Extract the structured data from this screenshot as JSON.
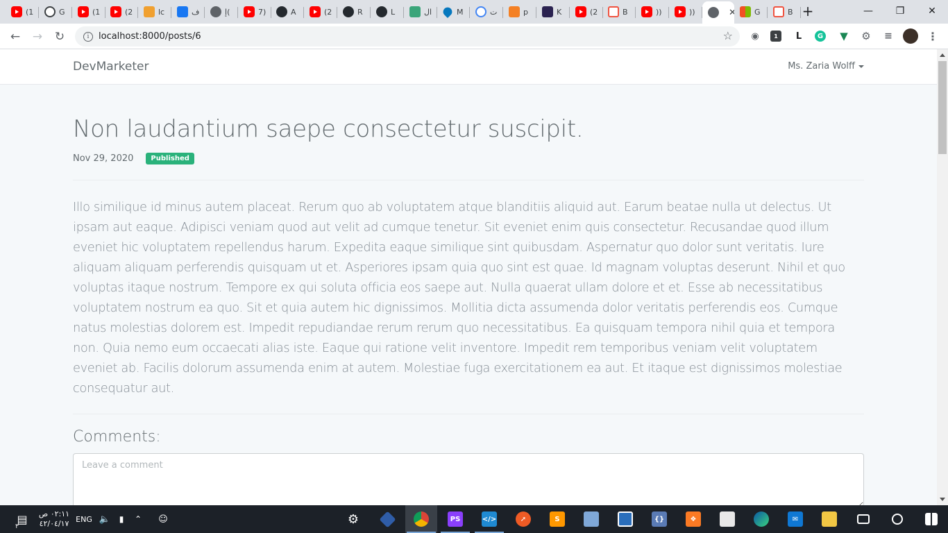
{
  "browser": {
    "tabs": [
      {
        "icon": "youtube-icon",
        "title": "(1"
      },
      {
        "icon": "clock-icon",
        "title": "G"
      },
      {
        "icon": "youtube-icon",
        "title": "(1"
      },
      {
        "icon": "youtube-icon",
        "title": "(2"
      },
      {
        "icon": "phpmyadmin-icon",
        "title": "lc"
      },
      {
        "icon": "facebook-icon",
        "title": "ف"
      },
      {
        "icon": "globe-icon",
        "title": "إ("
      },
      {
        "icon": "youtube-icon",
        "title": "7)"
      },
      {
        "icon": "github-icon",
        "title": "A"
      },
      {
        "icon": "youtube-icon",
        "title": "(2"
      },
      {
        "icon": "github-icon",
        "title": "R"
      },
      {
        "icon": "github-icon",
        "title": "L"
      },
      {
        "icon": "book-icon",
        "title": "ال"
      },
      {
        "icon": "drupal-icon",
        "title": "M"
      },
      {
        "icon": "google-icon",
        "title": "ت"
      },
      {
        "icon": "stackoverflow-icon",
        "title": "p"
      },
      {
        "icon": "k-icon",
        "title": "K"
      },
      {
        "icon": "youtube-icon",
        "title": "(2"
      },
      {
        "icon": "laravel-icon",
        "title": "B"
      },
      {
        "icon": "youtube-icon",
        "title": "))"
      },
      {
        "icon": "youtube-icon",
        "title": "))"
      },
      {
        "icon": "globe-icon",
        "title": ""
      },
      {
        "icon": "microsoft-icon",
        "title": "G"
      },
      {
        "icon": "laravel-icon",
        "title": "B"
      }
    ],
    "url": "localhost:8000/posts/6",
    "extension_letter": "L",
    "extension_badge": "1"
  },
  "app": {
    "brand": "DevMarketer",
    "user_name": "Ms. Zaria Wolff"
  },
  "post": {
    "title": "Non laudantium saepe consectetur suscipit.",
    "date": "Nov 29, 2020",
    "status": "Published",
    "body": "Illo similique id minus autem placeat. Rerum quo ab voluptatem atque blanditiis aliquid aut. Earum beatae nulla ut delectus. Ut ipsam aut eaque. Adipisci veniam quod aut velit ad cumque tenetur. Sit eveniet enim quis consectetur. Recusandae quod illum eveniet hic voluptatem repellendus harum. Expedita eaque similique sint quibusdam. Aspernatur quo dolor sunt veritatis. Iure aliquam aliquam perferendis quisquam ut et. Asperiores ipsam quia quo sint est quae. Id magnam voluptas deserunt. Nihil et quo voluptas itaque nostrum. Tempore ex qui soluta officia eos saepe aut. Nulla quaerat ullam dolore et et. Esse ab necessitatibus voluptatem nostrum ea quo. Sit et quia autem hic dignissimos. Mollitia dicta assumenda dolor veritatis perferendis eos. Cumque natus molestias dolorem est. Impedit repudiandae rerum rerum quo necessitatibus. Ea quisquam tempora nihil quia et tempora non. Quia nemo eum occaecati alias iste. Eaque qui ratione velit inventore. Impedit rem temporibus veniam velit voluptatem eveniet ab. Facilis dolorum assumenda enim at autem. Molestiae fuga exercitationem ea aut. Et itaque est dignissimos molestiae consequatur aut."
  },
  "comments": {
    "heading": "Comments:",
    "placeholder": "Leave a comment"
  },
  "taskbar": {
    "language": "ENG",
    "time": "٠٢:١١ ص",
    "date": "٤٢/٠٤/١٧",
    "notification_count": "٣"
  }
}
